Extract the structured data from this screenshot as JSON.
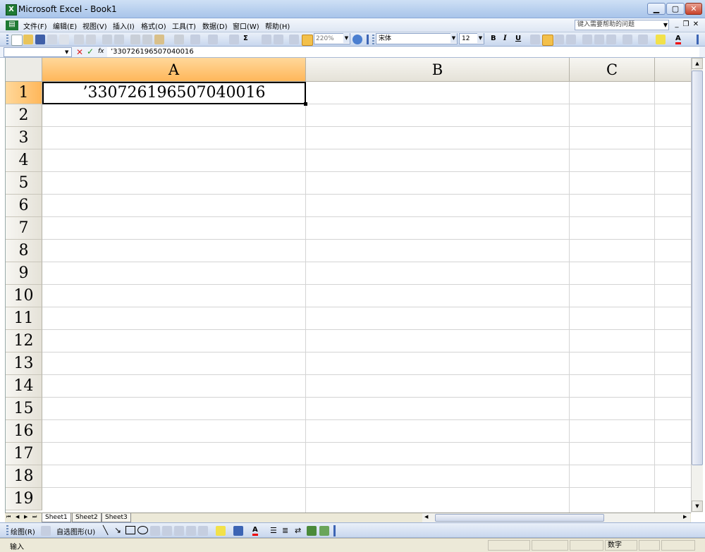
{
  "window": {
    "title": "Microsoft Excel - Book1",
    "app_icon": "X"
  },
  "menu": {
    "items": [
      "文件(F)",
      "编辑(E)",
      "视图(V)",
      "插入(I)",
      "格式(O)",
      "工具(T)",
      "数据(D)",
      "窗口(W)",
      "帮助(H)"
    ],
    "help_placeholder": "键入需要帮助的问题"
  },
  "toolbar": {
    "zoom": "220%",
    "font_name": "宋体",
    "font_size": "12",
    "bold": "B",
    "italic": "I",
    "underline": "U",
    "font_color_label": "A",
    "sum_label": "Σ"
  },
  "formula_bar": {
    "name_box": "",
    "content": "’330726196507040016",
    "fx_label": "fx"
  },
  "grid": {
    "columns": [
      "A",
      "B",
      "C"
    ],
    "rows": [
      "1",
      "2",
      "3",
      "4",
      "5",
      "6",
      "7",
      "8",
      "9",
      "10",
      "11",
      "12",
      "13",
      "14",
      "15",
      "16",
      "17",
      "18",
      "19"
    ],
    "selected_column": "A",
    "selected_row": "1",
    "cells": {
      "A1": "’330726196507040016"
    }
  },
  "sheets": {
    "tabs": [
      "Sheet1",
      "Sheet2",
      "Sheet3"
    ],
    "active": "Sheet1"
  },
  "drawing": {
    "draw_label": "绘图(R)",
    "autoshapes_label": "自选图形(U)"
  },
  "status": {
    "mode": "输入",
    "num": "数字"
  },
  "colors": {
    "title_bar": "#b7cfee",
    "selected_header": "#ffb75a",
    "excel_green": "#1f7a33"
  }
}
